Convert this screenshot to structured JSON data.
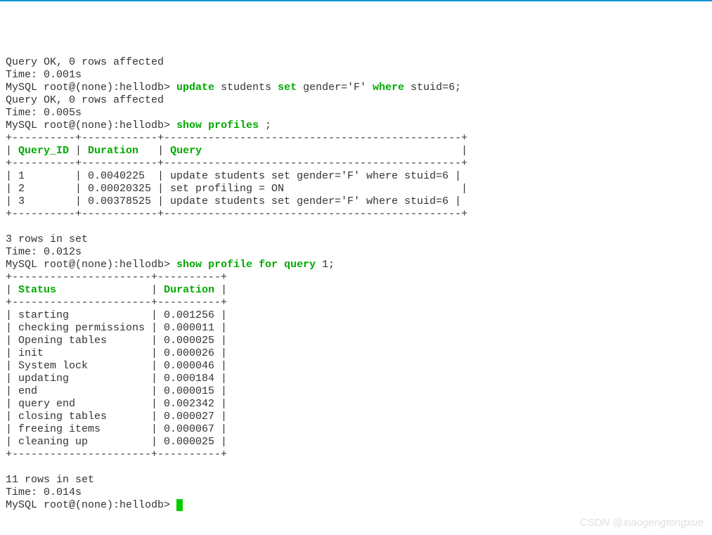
{
  "result1": "Query OK, 0 rows affected",
  "time1": "Time: 0.001s",
  "prompt": "MySQL root@(none):hellodb> ",
  "cmd1_kw1": "update",
  "cmd1_txt1": " students ",
  "cmd1_kw2": "set",
  "cmd1_txt2": " gender='F' ",
  "cmd1_kw3": "where",
  "cmd1_txt3": " stuid=6;",
  "result2": "Query OK, 0 rows affected",
  "time2": "Time: 0.005s",
  "cmd2_kw1": "show",
  "cmd2_kw2": " profiles ",
  "cmd2_txt": ";",
  "profiles_border": "+----------+------------+-----------------------------------------------+",
  "profiles_header_pipe1": "| ",
  "profiles_header_qid": "Query_ID",
  "profiles_header_pipe2": " | ",
  "profiles_header_dur": "Duration",
  "profiles_header_pipe3": "   | ",
  "profiles_header_q": "Query",
  "profiles_header_pipe4": "                                         |",
  "profiles_rows": [
    "| 1        | 0.0040225  | update students set gender='F' where stuid=6 |",
    "| 2        | 0.00020325 | set profiling = ON                            |",
    "| 3        | 0.00378525 | update students set gender='F' where stuid=6 |"
  ],
  "profiles_summary": "3 rows in set",
  "time3": "Time: 0.012s",
  "cmd3_kw1": "show",
  "cmd3_kw2": " profile for query ",
  "cmd3_txt": "1;",
  "profile_border": "+----------------------+----------+",
  "profile_header_pipe1": "| ",
  "profile_header_status": "Status",
  "profile_header_pipe2": "               | ",
  "profile_header_dur": "Duration",
  "profile_header_pipe3": " |",
  "profile_rows": [
    "| starting             | 0.001256 |",
    "| checking permissions | 0.000011 |",
    "| Opening tables       | 0.000025 |",
    "| init                 | 0.000026 |",
    "| System lock          | 0.000046 |",
    "| updating             | 0.000184 |",
    "| end                  | 0.000015 |",
    "| query end            | 0.002342 |",
    "| closing tables       | 0.000027 |",
    "| freeing items        | 0.000067 |",
    "| cleaning up          | 0.000025 |"
  ],
  "profile_summary": "11 rows in set",
  "time4": "Time: 0.014s",
  "watermark": "CSDN @xiaogengtongxue",
  "chart_data": {
    "type": "table",
    "tables": [
      {
        "title": "show profiles",
        "columns": [
          "Query_ID",
          "Duration",
          "Query"
        ],
        "rows": [
          [
            1,
            0.0040225,
            "update students set gender='F' where stuid=6"
          ],
          [
            2,
            0.00020325,
            "set profiling = ON"
          ],
          [
            3,
            0.00378525,
            "update students set gender='F' where stuid=6"
          ]
        ]
      },
      {
        "title": "show profile for query 1",
        "columns": [
          "Status",
          "Duration"
        ],
        "rows": [
          [
            "starting",
            0.001256
          ],
          [
            "checking permissions",
            1.1e-05
          ],
          [
            "Opening tables",
            2.5e-05
          ],
          [
            "init",
            2.6e-05
          ],
          [
            "System lock",
            4.6e-05
          ],
          [
            "updating",
            0.000184
          ],
          [
            "end",
            1.5e-05
          ],
          [
            "query end",
            0.002342
          ],
          [
            "closing tables",
            2.7e-05
          ],
          [
            "freeing items",
            6.7e-05
          ],
          [
            "cleaning up",
            2.5e-05
          ]
        ]
      }
    ]
  }
}
